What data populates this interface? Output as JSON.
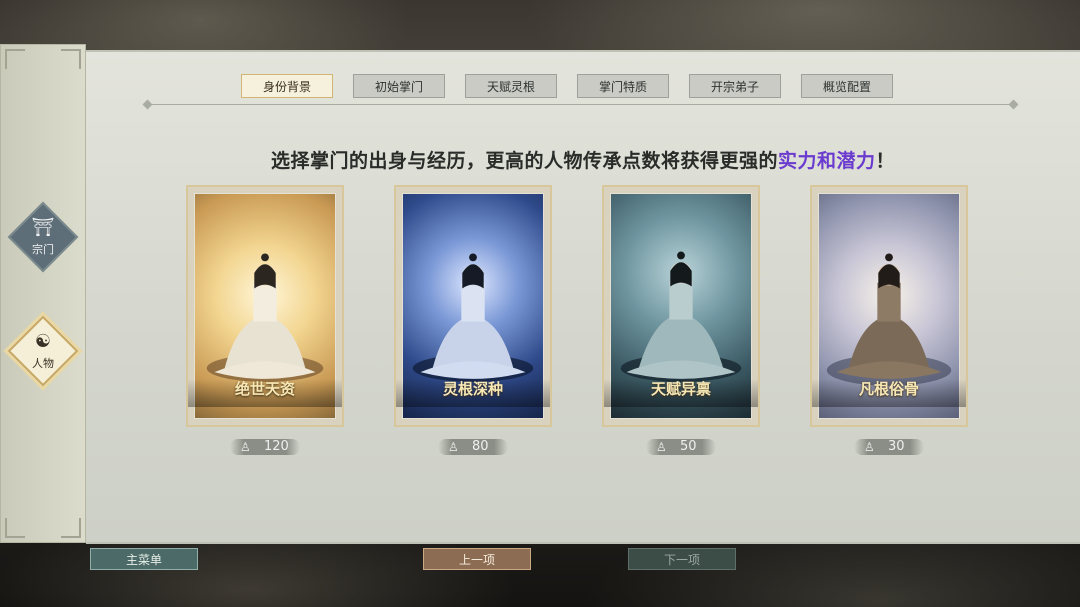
{
  "sidebar": {
    "items": [
      {
        "label": "宗门",
        "icon": "temple-icon",
        "active": false
      },
      {
        "label": "人物",
        "icon": "meditating-person-icon",
        "active": true
      }
    ]
  },
  "tabs": [
    "身份背景",
    "初始掌门",
    "天赋灵根",
    "掌门特质",
    "开宗弟子",
    "概览配置"
  ],
  "active_tab": "身份背景",
  "headline": {
    "text": "选择掌门的出身与经历，更高的人物传承点数将获得更强的",
    "highlight": "实力和潜力",
    "suffix": "！"
  },
  "cards": [
    {
      "name": "绝世天资",
      "cost": "120",
      "theme": "#e9c37a"
    },
    {
      "name": "灵根深种",
      "cost": "80",
      "theme": "#3d5a9a"
    },
    {
      "name": "天赋异禀",
      "cost": "50",
      "theme": "#4f7680"
    },
    {
      "name": "凡根俗骨",
      "cost": "30",
      "theme": "#9aa1b7"
    }
  ],
  "cost_icon": "inheritance-point-icon",
  "buttons": {
    "main_menu": "主菜单",
    "prev": "上一项",
    "next": "下一项"
  }
}
